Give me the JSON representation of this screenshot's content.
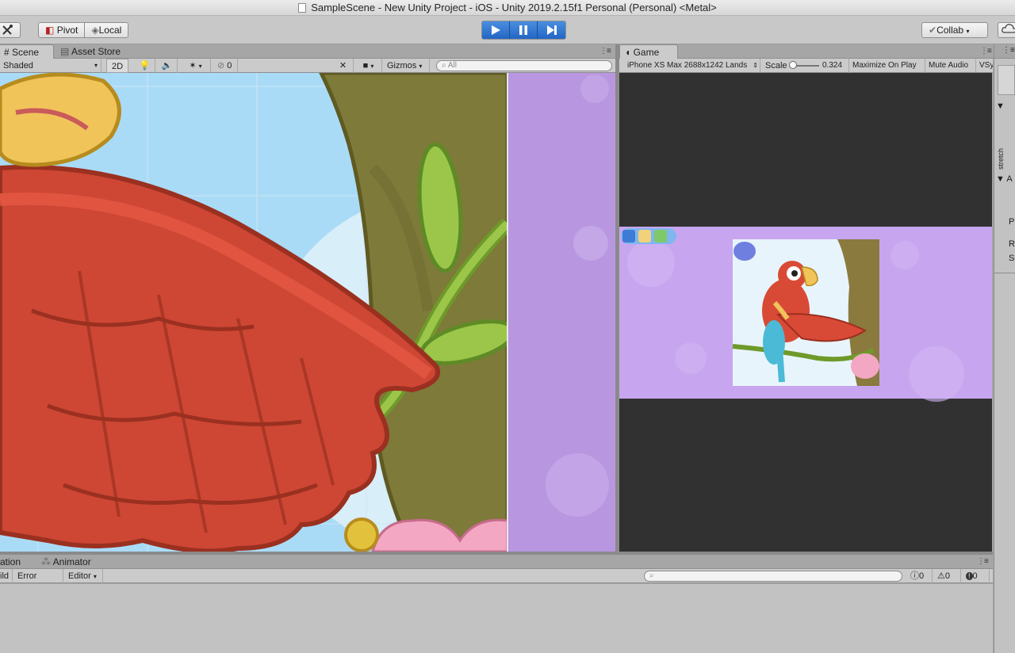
{
  "window": {
    "title": "SampleScene - New Unity Project - iOS - Unity 2019.2.15f1 Personal (Personal) <Metal>"
  },
  "toolbar": {
    "pivot_label": "Pivot",
    "local_label": "Local",
    "collab_label": "Collab"
  },
  "scene_panel": {
    "tabs": [
      {
        "label": "Scene"
      },
      {
        "label": "Asset Store"
      }
    ],
    "toolbar": {
      "shading_mode": "Shaded",
      "mode_2d": "2D",
      "hidden_count": "0",
      "gizmos_label": "Gizmos",
      "search_placeholder": "All"
    }
  },
  "game_panel": {
    "tab_label": "Game",
    "toolbar": {
      "resolution": "iPhone XS Max 2688x1242 Lands",
      "scale_label": "Scale",
      "scale_value": "0.324",
      "maximize_label": "Maximize On Play",
      "mute_label": "Mute Audio",
      "vsync_label": "VSy"
    }
  },
  "bottom_panel": {
    "tabs": [
      {
        "label": "ation"
      },
      {
        "label": "Animator"
      }
    ],
    "toolbar": {
      "build_label": "ild",
      "error_pause_label": "Error Pause",
      "editor_label": "Editor",
      "log_count": "0",
      "warning_count": "0",
      "error_count": "0"
    }
  },
  "inspector": {
    "stretch_label": "stretch",
    "row_a": "A",
    "row_pi": "Pi",
    "row_re": "Re",
    "row_se": "Se"
  },
  "colors": {
    "play_active": "#2f7be0",
    "scene_sky": "#bfe3fa",
    "game_bg": "#313131",
    "purple_bg": "#c3a6ee",
    "parrot_red": "#cd4734"
  }
}
